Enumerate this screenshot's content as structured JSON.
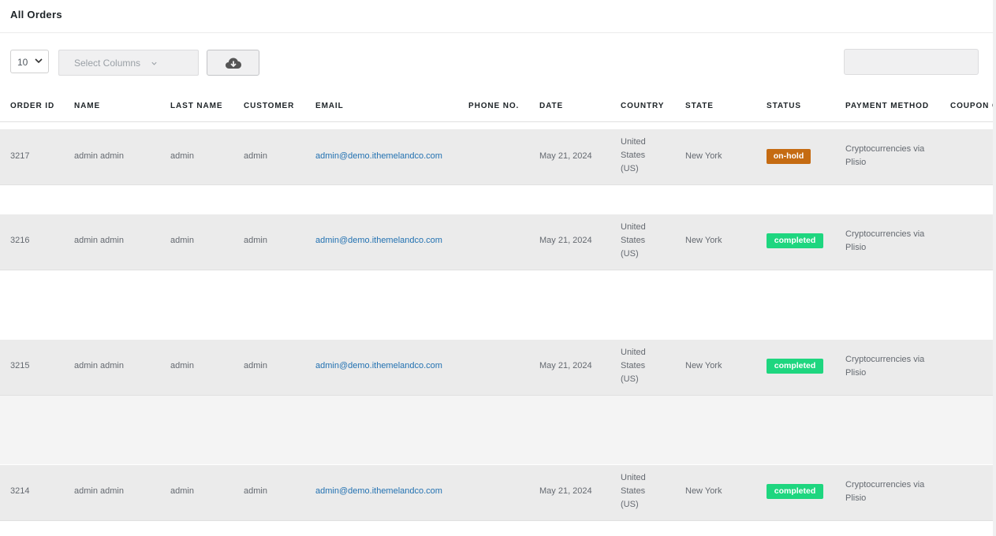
{
  "page": {
    "title": "All Orders"
  },
  "toolbar": {
    "per_page": "10",
    "select_columns_placeholder": "Select Columns",
    "export_icon": "cloud-download-icon",
    "search_placeholder": ""
  },
  "columns": [
    "ORDER ID",
    "NAME",
    "LAST NAME",
    "CUSTOMER",
    "EMAIL",
    "PHONE NO.",
    "DATE",
    "COUNTRY",
    "STATE",
    "STATUS",
    "PAYMENT METHOD",
    "COUPON CODE"
  ],
  "rows": [
    {
      "order_id": "3217",
      "name": "admin admin",
      "last_name": "admin",
      "customer": "admin",
      "email": "admin@demo.ithemelandco.com",
      "phone": "",
      "date": "May 21, 2024",
      "country": [
        "United",
        "States",
        "(US)"
      ],
      "state": "New York",
      "status": "on-hold",
      "payment": [
        "Cryptocurrencies via",
        "Plisio"
      ]
    },
    {
      "order_id": "3216",
      "name": "admin admin",
      "last_name": "admin",
      "customer": "admin",
      "email": "admin@demo.ithemelandco.com",
      "phone": "",
      "date": "May 21, 2024",
      "country": [
        "United",
        "States",
        "(US)"
      ],
      "state": "New York",
      "status": "completed",
      "payment": [
        "Cryptocurrencies via",
        "Plisio"
      ]
    },
    {
      "order_id": "3215",
      "name": "admin admin",
      "last_name": "admin",
      "customer": "admin",
      "email": "admin@demo.ithemelandco.com",
      "phone": "",
      "date": "May 21, 2024",
      "country": [
        "United",
        "States",
        "(US)"
      ],
      "state": "New York",
      "status": "completed",
      "payment": [
        "Cryptocurrencies via",
        "Plisio"
      ]
    },
    {
      "order_id": "3214",
      "name": "admin admin",
      "last_name": "admin",
      "customer": "admin",
      "email": "admin@demo.ithemelandco.com",
      "phone": "",
      "date": "May 21, 2024",
      "country": [
        "United",
        "States",
        "(US)"
      ],
      "state": "New York",
      "status": "completed",
      "payment": [
        "Cryptocurrencies via",
        "Plisio"
      ]
    }
  ],
  "colors": {
    "on_hold": "#c56b12",
    "completed": "#1ed67f",
    "link": "#2271b1",
    "row_bg": "#ebebeb"
  }
}
